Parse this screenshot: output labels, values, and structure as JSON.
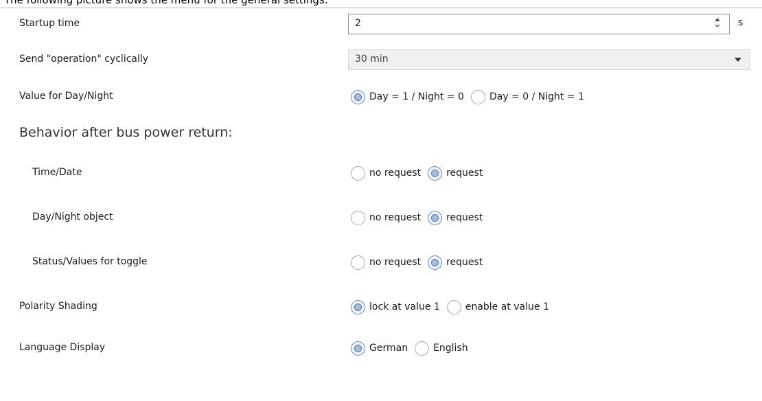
{
  "caption": "The following picture shows the menu for the general settings:",
  "startup": {
    "label": "Startup time",
    "value": "2",
    "unit": "s"
  },
  "cyclic": {
    "label": "Send \"operation\" cyclically",
    "value": "30 min"
  },
  "daynight": {
    "label": "Value for Day/Night",
    "options": [
      "Day = 1 / Night = 0",
      "Day = 0 / Night = 1"
    ],
    "selected": 0
  },
  "behavior_heading": "Behavior after bus power return:",
  "timedate": {
    "label": "Time/Date",
    "options": [
      "no request",
      "request"
    ],
    "selected": 1
  },
  "daynight_obj": {
    "label": "Day/Night object",
    "options": [
      "no request",
      "request"
    ],
    "selected": 1
  },
  "status_toggle": {
    "label": "Status/Values for toggle",
    "options": [
      "no request",
      "request"
    ],
    "selected": 1
  },
  "polarity": {
    "label": "Polarity Shading",
    "options": [
      "lock at value 1",
      "enable at value 1"
    ],
    "selected": 0
  },
  "language": {
    "label": "Language Display",
    "options": [
      "German",
      "English"
    ],
    "selected": 0
  },
  "colors": {
    "border": "#b9b9b9",
    "radio_selected": "#a7bddd",
    "select_bg": "#f0f0f0"
  }
}
